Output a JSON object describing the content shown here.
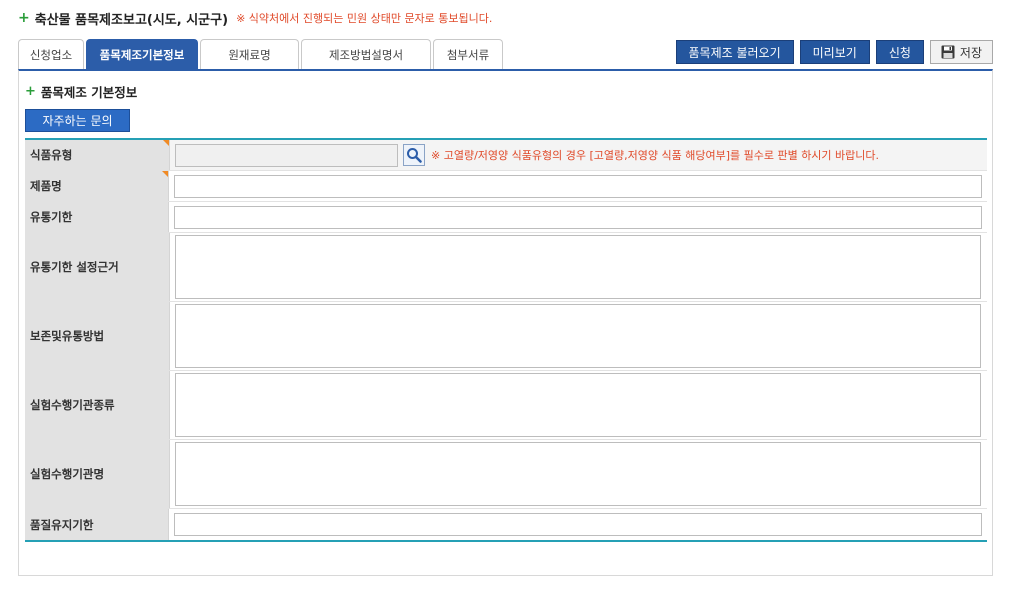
{
  "header": {
    "title": "축산물 품목제조보고(시도, 시군구)",
    "notice": "※ 식약처에서 진행되는 민원 상태만 문자로 통보됩니다."
  },
  "tabs": [
    {
      "label": "신청업소"
    },
    {
      "label": "품목제조기본정보"
    },
    {
      "label": "원재료명"
    },
    {
      "label": "제조방법설명서"
    },
    {
      "label": "첨부서류"
    }
  ],
  "actions": {
    "load_label": "품목제조 불러오기",
    "preview_label": "미리보기",
    "apply_label": "신청",
    "save_label": "저장"
  },
  "section": {
    "title": "품목제조 기본정보",
    "faq_label": "자주하는 문의"
  },
  "form": {
    "food_type_label": "식품유형",
    "food_type_value": "",
    "food_type_hint": "※ 고열량/저영양 식품유형의 경우 [고열량,저영양 식품 해당여부]를 필수로 판별 하시기 바랍니다.",
    "product_name_label": "제품명",
    "product_name_value": "",
    "shelf_life_label": "유통기한",
    "shelf_life_value": "",
    "shelf_life_basis_label": "유통기한 설정근거",
    "shelf_life_basis_value": "",
    "storage_method_label": "보존및유통방법",
    "storage_method_value": "",
    "test_agency_type_label": "실험수행기관종류",
    "test_agency_type_value": "",
    "test_agency_name_label": "실험수행기관명",
    "test_agency_name_value": "",
    "quality_period_label": "품질유지기한",
    "quality_period_value": ""
  },
  "colors": {
    "accent": "#2c5da9",
    "notice": "#e04a2a",
    "form_border": "#25a0b5",
    "required_marker": "#f08a24"
  }
}
